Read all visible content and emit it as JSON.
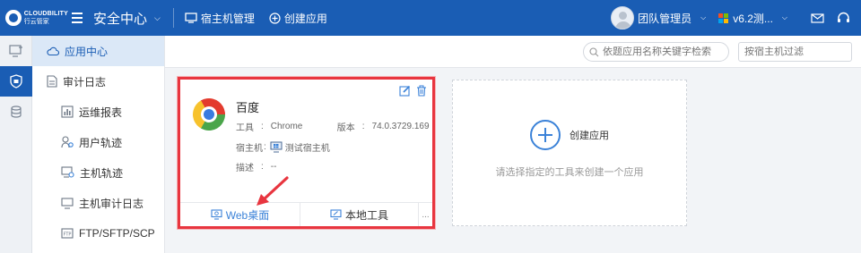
{
  "header": {
    "brand_en": "CLOUDBILITY",
    "brand_cn": "行云管家",
    "module": "安全中心",
    "links": [
      {
        "label": "宿主机管理",
        "icon": "monitor-icon"
      },
      {
        "label": "创建应用",
        "icon": "plus-circle-icon"
      }
    ],
    "user": "团队管理员",
    "version": "v6.2测..."
  },
  "rail": [
    "monitor-plus-icon",
    "shield-icon",
    "database-icon"
  ],
  "sidebar": {
    "items": [
      {
        "label": "应用中心",
        "icon": "cloud-icon"
      },
      {
        "label": "审计日志",
        "icon": "document-icon"
      },
      {
        "label": "运维报表",
        "icon": "report-icon"
      },
      {
        "label": "用户轨迹",
        "icon": "user-track-icon"
      },
      {
        "label": "主机轨迹",
        "icon": "host-track-icon"
      },
      {
        "label": "主机审计日志",
        "icon": "monitor-icon"
      },
      {
        "label": "FTP/SFTP/SCP",
        "icon": "ftp-icon"
      }
    ]
  },
  "filters": {
    "search_placeholder": "依题应用名称关键字检索",
    "host_placeholder": "按宿主机过滤"
  },
  "app_card": {
    "name": "百度",
    "tool_key": "工具",
    "tool_value": "Chrome",
    "version_key": "版本",
    "version_value": "74.0.3729.169",
    "host_key": "宿主机",
    "host_value": "测试宿主机",
    "desc_key": "描述",
    "desc_value": "--",
    "web_label": "Web桌面",
    "local_label": "本地工具",
    "more_label": "..."
  },
  "create_card": {
    "label": "创建应用",
    "hint": "请选择指定的工具来创建一个应用"
  },
  "colors": {
    "brand": "#1a5db4",
    "highlight": "#e8353f",
    "link": "#3b82d8"
  }
}
